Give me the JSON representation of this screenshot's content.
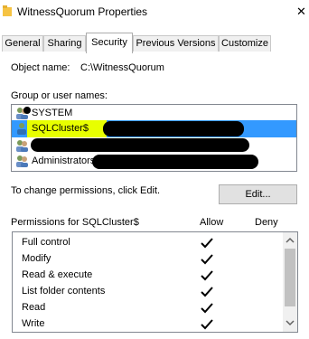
{
  "window": {
    "title": "WitnessQuorum Properties",
    "icons": {
      "folder": "folder-icon",
      "close": "close-icon"
    }
  },
  "tabs": [
    {
      "label": "General",
      "active": false
    },
    {
      "label": "Sharing",
      "active": false
    },
    {
      "label": "Security",
      "active": true
    },
    {
      "label": "Previous Versions",
      "active": false
    },
    {
      "label": "Customize",
      "active": false
    }
  ],
  "security": {
    "object_name_label": "Object name:",
    "object_name_value": "C:\\WitnessQuorum",
    "group_label": "Group or user names:",
    "principals": [
      {
        "name": "SYSTEM",
        "icon": "users-icon",
        "selected": false
      },
      {
        "name": "SQLCluster$",
        "icon": "user-icon",
        "selected": true,
        "highlighted": true
      },
      {
        "name": "",
        "icon": "users-icon",
        "selected": false,
        "redacted": true
      },
      {
        "name": "Administrators",
        "icon": "users-icon",
        "selected": false
      }
    ],
    "change_text": "To change permissions, click Edit.",
    "edit_button": "Edit...",
    "permissions_header": "Permissions for SQLCluster$",
    "allow_header": "Allow",
    "deny_header": "Deny",
    "permissions": [
      {
        "name": "Full control",
        "allow": true,
        "deny": false
      },
      {
        "name": "Modify",
        "allow": true,
        "deny": false
      },
      {
        "name": "Read & execute",
        "allow": true,
        "deny": false
      },
      {
        "name": "List folder contents",
        "allow": true,
        "deny": false
      },
      {
        "name": "Read",
        "allow": true,
        "deny": false
      },
      {
        "name": "Write",
        "allow": true,
        "deny": false
      }
    ]
  },
  "colors": {
    "selection": "#3399ff",
    "highlight": "#e8ff00",
    "redaction": "#000000"
  }
}
